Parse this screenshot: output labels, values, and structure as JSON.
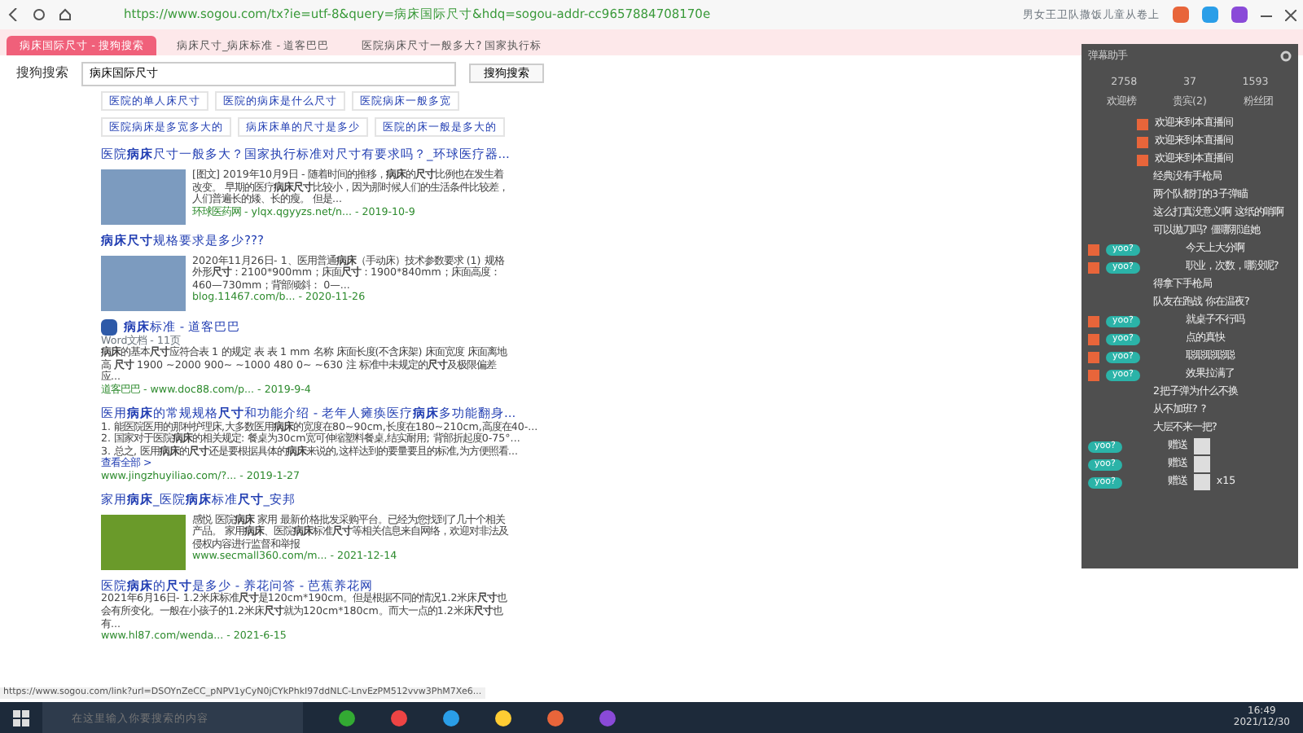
{
  "browser": {
    "address": "https://www.sogou.com/tx?ie=utf-8&query=病床国际尺寸&hdq=sogou-addr-cc9657884708170e",
    "news": "男女王卫队撒饭儿童从卷上",
    "tabs": [
      {
        "label": "病床国际尺寸 - 搜狗搜索",
        "selected": true
      },
      {
        "label": "病床尺寸_病床标准 - 道客巴巴",
        "selected": false
      },
      {
        "label": "医院病床尺寸一般多大? 国家执行标",
        "selected": false
      }
    ],
    "status_url": "https://www.sogou.com/link?url=DSOYnZeCC_pNPV1yCyN0jCYkPhkI97ddNLC-LnvEzPM512vvw3PhM7Xe6..."
  },
  "search": {
    "logo": "搜狗搜索",
    "query": "病床国际尺寸",
    "button": "搜狗搜索",
    "related": [
      "医院的单人床尺寸",
      "医院的病床是什么尺寸",
      "医院病床一般多宽",
      "医院病床是多宽多大的",
      "病床床单的尺寸是多少",
      "医院的床一般是多大的"
    ]
  },
  "results": [
    {
      "kind": "image",
      "title": "医院**病床**尺寸一般多大？国家执行标准对尺寸有要求吗？_环球医疗器...",
      "snippet": "[图文] 2019年10月9日 - 随着时间的推移，**病床**的**尺寸**比例也在发生着改变。 早期的医疗**病床尺寸**比较小，因为那时候人们的生活条件比较差，人们普遍长的矮、长的瘦。 但是...",
      "url": "环球医药网 - ylqx.qgyyzs.net/n... - 2019-10-9"
    },
    {
      "kind": "image",
      "title": "**病床尺寸**规格要求是多少???",
      "snippet": "2020年11月26日- 1、医用普通**病床**（手动床）技术参数要求 (1) 规格外形**尺寸**：2100*900mm；床面**尺寸**：1900*840mm；床面高度：460—730mm；背部倾斜： 0—...",
      "url": "blog.11467.com/b... - 2020-11-26"
    },
    {
      "kind": "doc",
      "title": "**病床**标准 - 道客巴巴",
      "meta": "Word文档 - 11页",
      "snippet": "**病床**的基本**尺寸**应符合表 1 的规定 表 表 1 mm 名称 床面长度(不含床架) 床面宽度 床面离地高 **尺寸** 1900 ~2000 900~ ~1000 480 0~ ~630 注 标准中未规定的**尺寸**及极限偏差应...",
      "url": "道客巴巴 - www.doc88.com/p... - 2019-9-4"
    },
    {
      "kind": "list",
      "title": "医用**病床**的常规规格**尺寸**和功能介绍 - 老年人瘫痪医疗**病床**多功能翻身...",
      "lines": [
        "1. 能医院医用的那种护理床,大多数医用**病床**的宽度在80~90cm,长度在180~210cm,高度在40-...",
        "2. 国家对于医院**病床**的相关规定: 餐桌为30cm宽可伸缩塑料餐桌,结实耐用; 背部折起度0-75°...",
        "3. 总之, 医用**病床**的**尺寸**还是要根据具体的**病床**来说的,这样达到的要量要且的标准,为方便照看..."
      ],
      "more": "查看全部 >",
      "url": "www.jingzhuyiliao.com/?... - 2019-1-27"
    },
    {
      "kind": "image",
      "title": "家用**病床**_医院**病床**标准**尺寸**_安邦",
      "snippet": "感悦 医院**病床** 家用 最新价格批发采购平台。已经为您找到了几十个相关产品。 家用**病床**、医院**病床**标准**尺寸**等相关信息来自网络，欢迎对非法及侵权内容进行监督和举报",
      "url": "www.secmall360.com/m... - 2021-12-14"
    },
    {
      "kind": "text",
      "title": "医院**病床**的**尺寸**是多少 - 养花问答 - 芭蕉养花网",
      "snippet": "2021年6月16日- 1.2米床标准**尺寸**是120cm*190cm。但是根据不同的情况1.2米床**尺寸**也会有所变化。一般在小孩子的1.2米床**尺寸**就为120cm*180cm。而大一点的1.2米床**尺寸**也有...",
      "url": "www.hl87.com/wenda... - 2021-6-15"
    }
  ],
  "chat": {
    "title": "弹幕助手",
    "stats": [
      "2758",
      "37",
      "1593"
    ],
    "tabs": [
      "欢迎榜",
      "贵宾(2)",
      "粉丝团"
    ],
    "messages": [
      {
        "kind": "welcome",
        "text": "欢迎来到本直播间"
      },
      {
        "kind": "welcome",
        "text": "欢迎来到本直播间"
      },
      {
        "kind": "welcome",
        "text": "欢迎来到本直播间"
      },
      {
        "kind": "text",
        "text": "经典没有手枪局"
      },
      {
        "kind": "text",
        "text": "两个队都打的3子弹瞄"
      },
      {
        "kind": "text",
        "text": "这么打真没意义啊 这纸的哨啊"
      },
      {
        "kind": "text",
        "text": "可以抛刀吗? 僵哪那追她"
      },
      {
        "kind": "text",
        "badge": "yoo?",
        "text": "今天上大分啊"
      },
      {
        "kind": "text",
        "badge": "yoo?",
        "text": "职业，次数，哪没呢?"
      },
      {
        "kind": "text",
        "text": "得拿下手枪局"
      },
      {
        "kind": "text",
        "text": "队友在跑战 你在温夜?"
      },
      {
        "kind": "text",
        "badge": "yoo?",
        "text": "就桌子不行吗"
      },
      {
        "kind": "text",
        "badge": "yoo?",
        "text": "点的真快"
      },
      {
        "kind": "text",
        "badge": "yoo?",
        "text": "聪聪聪聪聪"
      },
      {
        "kind": "text",
        "badge": "yoo?",
        "text": "效果拉满了"
      },
      {
        "kind": "text",
        "text": "2把子弹为什么不换"
      },
      {
        "kind": "text",
        "text": "从不加班? ?"
      },
      {
        "kind": "text",
        "text": "大层不来一把?"
      },
      {
        "kind": "gift",
        "badge": "yoo?",
        "text": "赠送"
      },
      {
        "kind": "gift",
        "badge": "yoo?",
        "text": "赠送"
      },
      {
        "kind": "gift",
        "badge": "yoo?",
        "text": "赠送",
        "count": "x15"
      }
    ]
  },
  "taskbar": {
    "search_placeholder": "在这里输入你要搜索的内容",
    "time": "16:49",
    "date": "2021/12/30"
  }
}
